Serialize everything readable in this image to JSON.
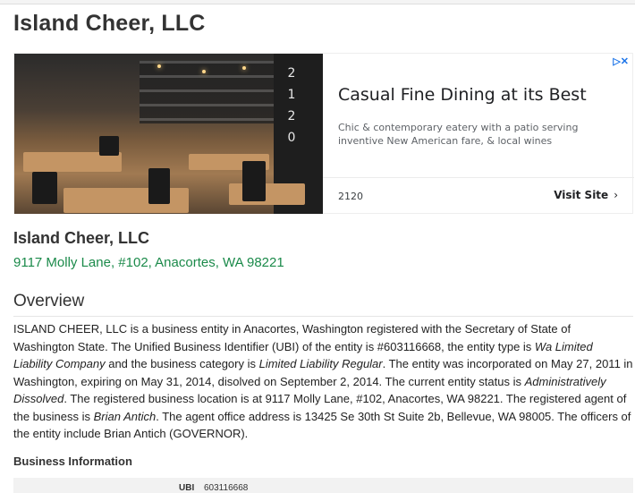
{
  "page": {
    "title": "Island Cheer, LLC"
  },
  "ad": {
    "choices_icon": "ad-choices-icon",
    "sign_digits": [
      "2",
      "1",
      "2",
      "0"
    ],
    "headline": "Casual Fine Dining at its Best",
    "description": "Chic & contemporary eatery with a patio serving inventive New American fare, & local wines",
    "domain": "2120",
    "cta": "Visit Site",
    "cta_icon": "chevron-right-icon"
  },
  "business": {
    "name": "Island Cheer, LLC",
    "address": "9117 Molly Lane, #102, Anacortes, WA 98221"
  },
  "overview": {
    "heading": "Overview",
    "p1": "ISLAND CHEER, LLC is a business entity in Anacortes, Washington registered with the Secretary of State of Washington State. The Unified Business Identifier (UBI) of the entity is #603116668, the entity type is ",
    "entity_type": "Wa Limited Liability Company",
    "p2": " and the business category is ",
    "category": "Limited Liability Regular",
    "p3": ". The entity was incorporated on May 27, 2011 in Washington, expiring on May 31, 2014, disolved on September 2, 2014. The current entity status is ",
    "status": "Administratively Dissolved",
    "p4": ". The registered business location is at 9117 Molly Lane, #102, Anacortes, WA 98221. The registered agent of the business is ",
    "agent": "Brian Antich",
    "p5": ". The agent office address is 13425 Se 30th St Suite 2b, Bellevue, WA 98005. The officers of the entity include Brian Antich (GOVERNOR)."
  },
  "business_information": {
    "heading": "Business Information",
    "rows": [
      {
        "label": "UBI",
        "value": "603116668"
      }
    ]
  }
}
